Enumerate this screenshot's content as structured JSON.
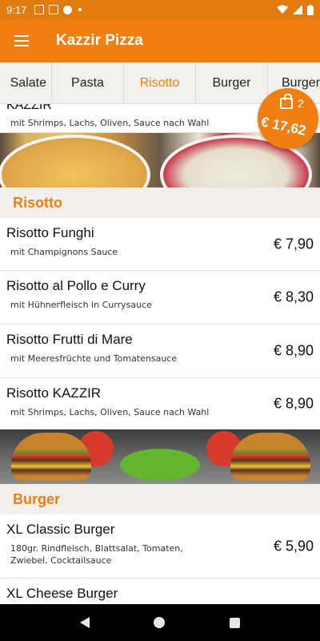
{
  "status_bar": {
    "time": "9:17"
  },
  "app_bar": {
    "title": "Kazzir Pizza",
    "menu_icon": "hamburger-menu-icon"
  },
  "tabs": [
    {
      "label": "Salate",
      "active": false
    },
    {
      "label": "Pasta",
      "active": false
    },
    {
      "label": "Risotto",
      "active": true
    },
    {
      "label": "Burger",
      "active": false
    },
    {
      "label": "Burger",
      "active": false
    }
  ],
  "cart": {
    "count": "2",
    "total": "€ 17,62"
  },
  "top_partial_item": {
    "name": "KAZZIR",
    "desc": "mit Shrimps, Lachs, Oliven, Sauce nach Wahl"
  },
  "sections": [
    {
      "title": "Risotto",
      "items": [
        {
          "name": "Risotto Funghi",
          "desc": "mit Champignons Sauce",
          "price": "€ 7,90"
        },
        {
          "name": "Risotto al Pollo e Curry",
          "desc": "mit Hühnerfleisch in Currysauce",
          "price": "€ 8,30"
        },
        {
          "name": "Risotto Frutti di Mare",
          "desc": "mit Meeresfrüchte und Tomatensauce",
          "price": "€ 8,90"
        },
        {
          "name": "Risotto KAZZIR",
          "desc": "mit Shrimps, Lachs, Oliven, Sauce nach Wahl",
          "price": "€ 8,90"
        }
      ]
    },
    {
      "title": "Burger",
      "items": [
        {
          "name": "XL Classic Burger",
          "desc": "180gr. Rindfleisch, Blattsalat, Tomaten, Zwiebel, Cocktailsauce",
          "price": "€ 5,90"
        },
        {
          "name": "XL Cheese Burger",
          "desc": "",
          "price": ""
        }
      ]
    }
  ],
  "colors": {
    "accent": "#ef7f10",
    "status_bar": "#e07b0e"
  }
}
